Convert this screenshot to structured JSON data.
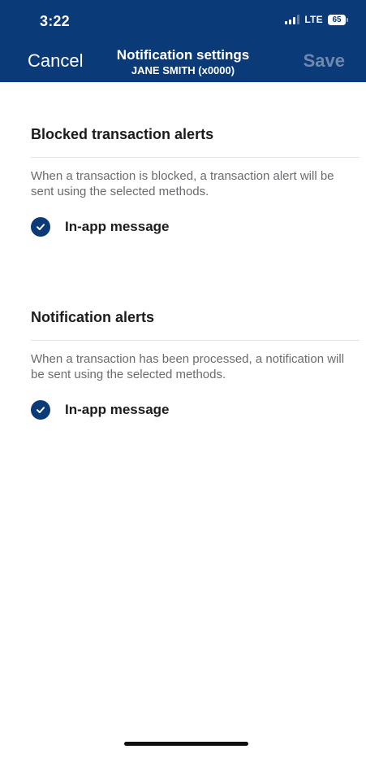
{
  "status_bar": {
    "time": "3:22",
    "network": "LTE",
    "battery": "65",
    "icons": [
      "signal-icon",
      "battery-icon"
    ]
  },
  "nav": {
    "cancel_label": "Cancel",
    "title": "Notification settings",
    "subtitle": "JANE SMITH (x0000)",
    "save_label": "Save"
  },
  "sections": [
    {
      "title": "Blocked transaction alerts",
      "description": "When a transaction is blocked, a transaction alert will be sent using the selected methods.",
      "options": [
        {
          "label": "In-app message",
          "checked": true
        }
      ]
    },
    {
      "title": "Notification alerts",
      "description": "When a transaction has been processed, a notification will be sent using the selected methods.",
      "options": [
        {
          "label": "In-app message",
          "checked": true
        }
      ]
    }
  ],
  "colors": {
    "header_bg": "#0b3a78",
    "save_disabled": "#6f89ad",
    "check_bg": "#0b3a78",
    "description_text": "#6b6b70"
  }
}
